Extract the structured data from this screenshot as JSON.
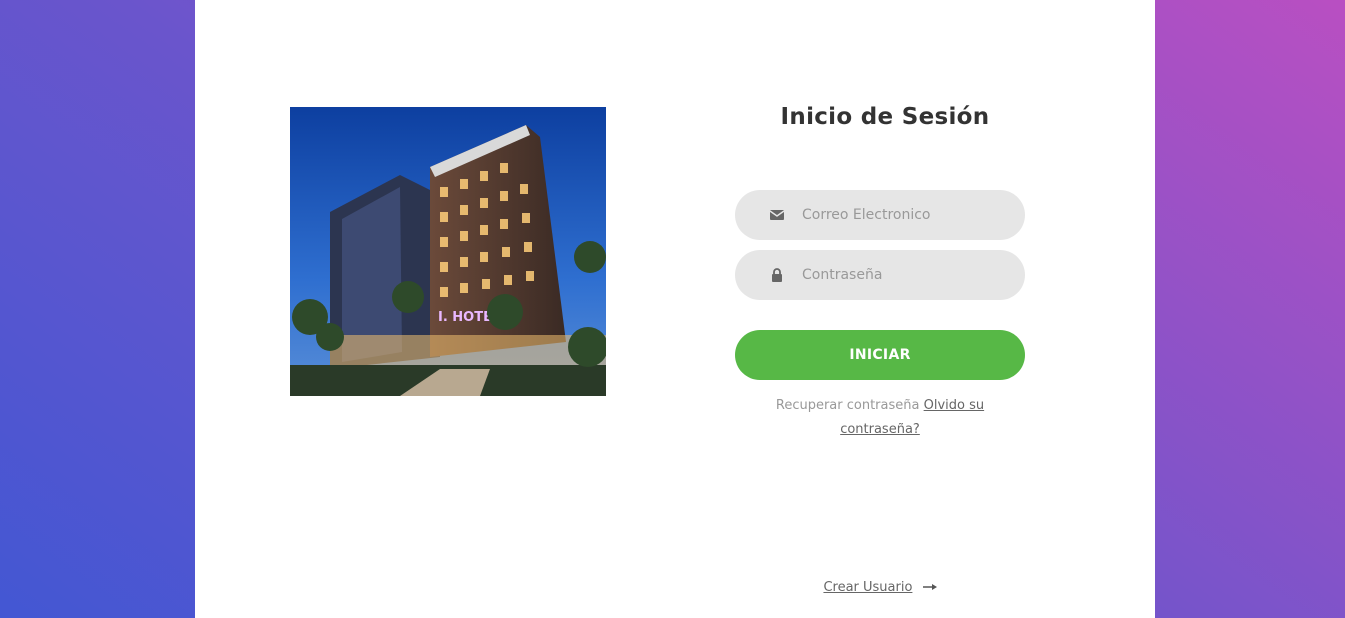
{
  "login": {
    "title": "Inicio de Sesión",
    "email_placeholder": "Correo Electronico",
    "password_placeholder": "Contraseña",
    "submit_label": "INICIAR",
    "recover_text": "Recuperar contraseña",
    "forgot_link": "Olvido su contraseña?",
    "create_user_link": "Crear Usuario",
    "icons": {
      "email": "envelope-icon",
      "password": "lock-icon",
      "create_user": "arrow-right-icon"
    }
  },
  "image": {
    "sign_text": "I. HOTEL"
  },
  "colors": {
    "accent": "#57b846",
    "field_bg": "#e6e6e6",
    "gradient_start": "#4357d3",
    "gradient_end": "#b94fc2"
  }
}
